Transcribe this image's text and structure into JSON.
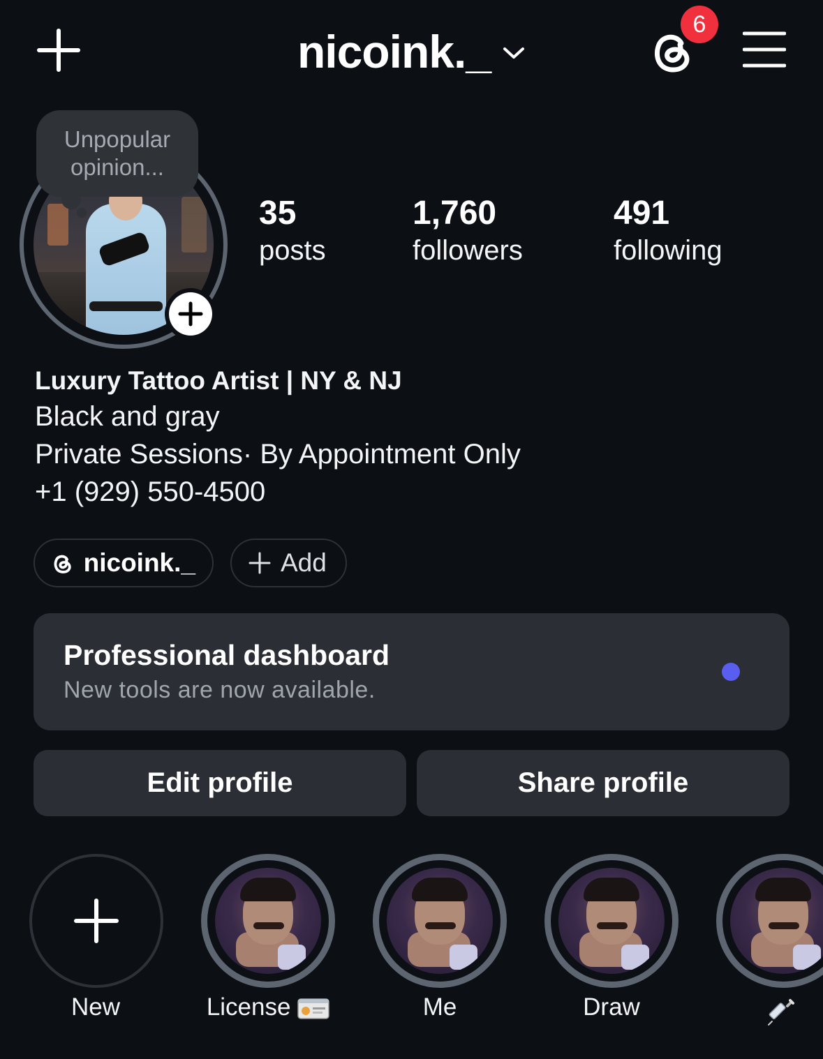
{
  "header": {
    "username": "nicoink._",
    "threads_badge_count": "6"
  },
  "profile": {
    "note": "Unpopular opinion...",
    "stats": [
      {
        "value": "35",
        "label": "posts"
      },
      {
        "value": "1,760",
        "label": "followers"
      },
      {
        "value": "491",
        "label": "following"
      }
    ],
    "bio": {
      "title": "Luxury Tattoo Artist | NY & NJ",
      "lines": [
        "Black and gray",
        "Private Sessions· By Appointment Only",
        "+1 (929) 550-4500"
      ]
    },
    "links": {
      "threads_handle": "nicoink._",
      "add_label": "Add"
    }
  },
  "dashboard": {
    "title": "Professional dashboard",
    "subtitle": "New tools are now available.",
    "dot_color": "#5a5ef0"
  },
  "actions": {
    "edit_label": "Edit profile",
    "share_label": "Share profile"
  },
  "highlights": [
    {
      "label": "New",
      "icon": "plus-icon"
    },
    {
      "label": "License",
      "icon": "id-card-emoji"
    },
    {
      "label": "Me"
    },
    {
      "label": "Draw"
    },
    {
      "label": "",
      "icon": "syringe-emoji"
    }
  ],
  "colors": {
    "background": "#0c0f14",
    "surface": "#2b2e35",
    "badge": "#f0303d",
    "ring": "#5d6670"
  }
}
